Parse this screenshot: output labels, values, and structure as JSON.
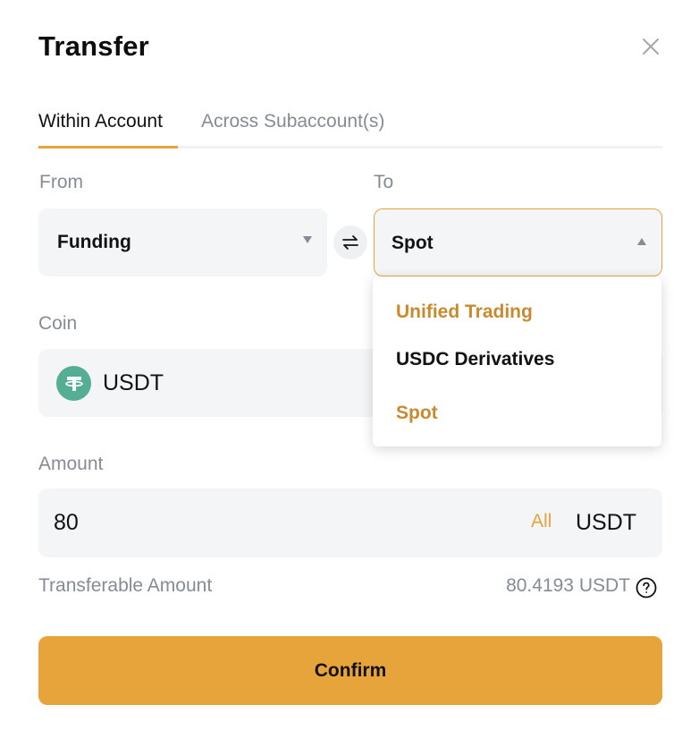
{
  "dialog": {
    "title": "Transfer"
  },
  "tabs": [
    {
      "label": "Within Account",
      "active": true
    },
    {
      "label": "Across Subaccount(s)",
      "active": false
    }
  ],
  "from": {
    "label": "From",
    "value": "Funding"
  },
  "to": {
    "label": "To",
    "value": "Spot"
  },
  "coin": {
    "label": "Coin",
    "value": "USDT",
    "icon": "tether-icon"
  },
  "amount": {
    "label": "Amount",
    "value": "80",
    "all_label": "All",
    "unit": "USDT"
  },
  "transferable": {
    "label": "Transferable Amount",
    "value": "80.4193 USDT"
  },
  "confirm_label": "Confirm",
  "dropdown": {
    "options": [
      {
        "label": "Unified Trading",
        "color": "#c98a2e"
      },
      {
        "label": "USDC Derivatives",
        "color": "#121214"
      },
      {
        "label": "Spot",
        "color": "#c98a2e"
      }
    ]
  },
  "colors": {
    "accent": "#e6a43b",
    "field_bg": "#f4f5f7",
    "muted_text": "#858c96",
    "coin_green": "#53ae94"
  }
}
